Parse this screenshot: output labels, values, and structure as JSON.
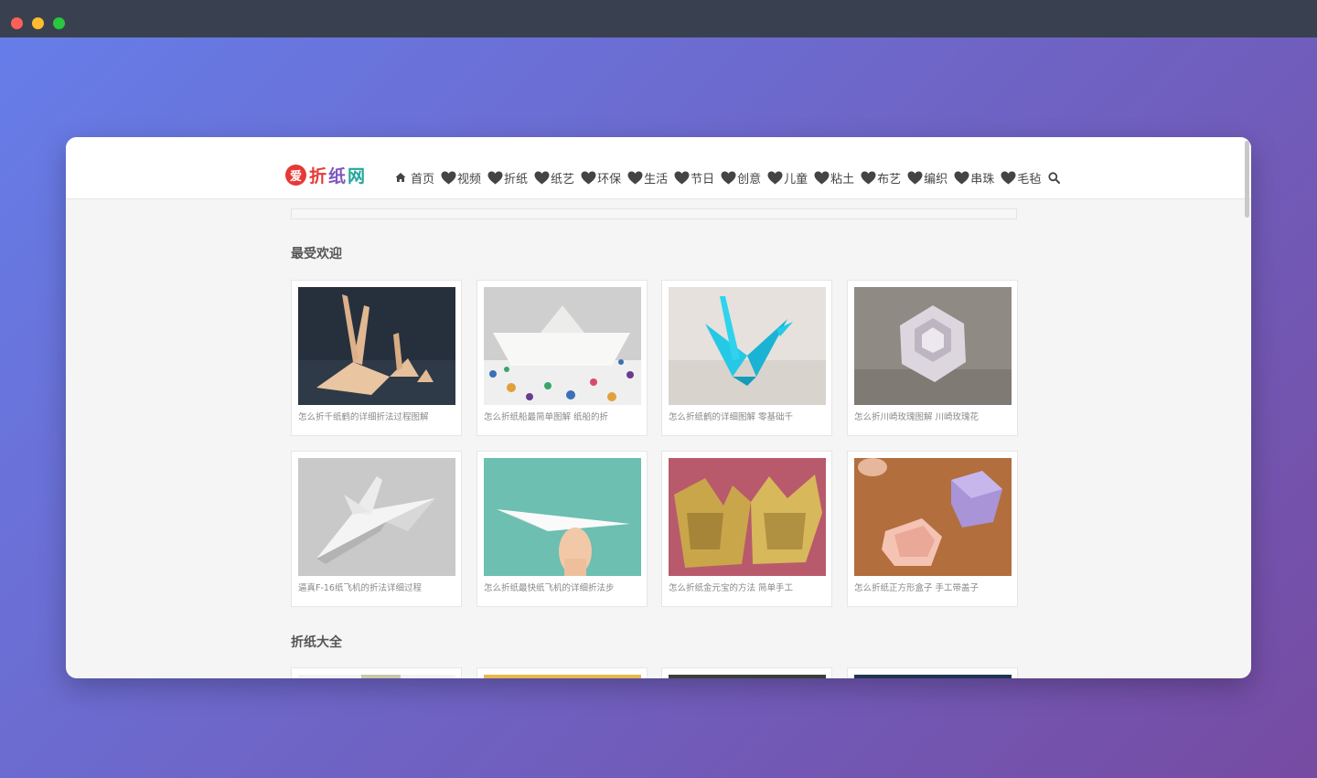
{
  "logo": {
    "badge": "爱",
    "c1": "折",
    "c2": "纸",
    "c3": "网"
  },
  "nav": {
    "home": "首页",
    "items": [
      "视频",
      "折纸",
      "纸艺",
      "环保",
      "生活",
      "节日",
      "创意",
      "儿童",
      "粘土",
      "布艺",
      "编织",
      "串珠",
      "毛毡"
    ]
  },
  "sections": {
    "popular": "最受欢迎",
    "all": "折纸大全"
  },
  "cards": [
    {
      "caption": "怎么折千纸鹤的详细折法过程图解"
    },
    {
      "caption": "怎么折纸船最简单图解 纸船的折"
    },
    {
      "caption": "怎么折纸鹤的详细图解 零基础千"
    },
    {
      "caption": "怎么折川崎玫瑰图解 川崎玫瑰花"
    },
    {
      "caption": "逼真F-16纸飞机的折法详细过程"
    },
    {
      "caption": "怎么折纸最快纸飞机的详细折法步"
    },
    {
      "caption": "怎么折纸金元宝的方法 简单手工"
    },
    {
      "caption": "怎么折纸正方形盒子 手工带盖子"
    }
  ],
  "colors": {
    "accent": "#e53935",
    "window_bg": "#394150"
  }
}
